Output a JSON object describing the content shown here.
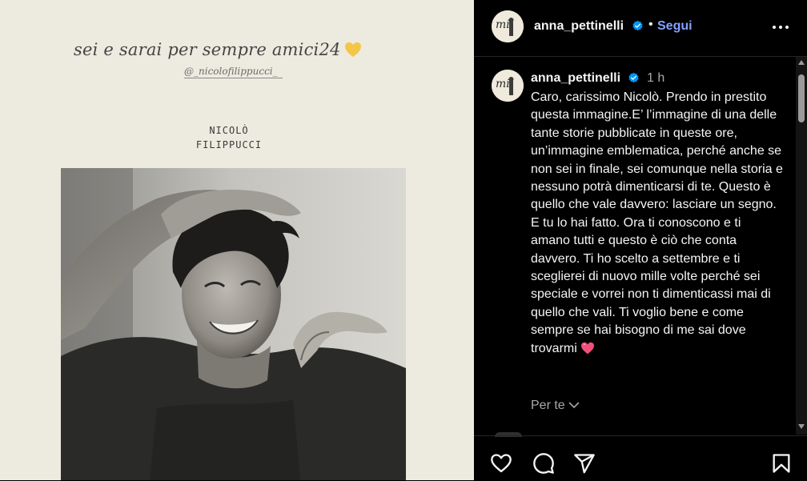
{
  "story": {
    "caption": "sei e sarai per sempre amici24",
    "mention": "@_nicolofilippucci_",
    "name_line1": "NICOLÒ",
    "name_line2": "FILIPPUCCI"
  },
  "header": {
    "username": "anna_pettinelli",
    "separator": "•",
    "follow_label": "Segui",
    "icons": [
      "verified-badge",
      "more-options-icon"
    ]
  },
  "comment": {
    "username": "anna_pettinelli",
    "time": "1 h",
    "text": "Caro, carissimo Nicolò. Prendo in prestito questa immagine.E’ l’immagine di una delle tante storie pubblicate in queste ore, un’immagine emblematica, perché anche se non sei in finale, sei comunque nella storia e nessuno potrà dimenticarsi di te. Questo è quello che vale davvero: lasciare un segno. E tu lo hai fatto. Ora ti conoscono e ti amano tutti e questo è ciò che conta davvero. Ti ho scelto a settembre e ti sceglierei di nuovo mille volte perché sei speciale e vorrei non ti dimenticassi mai di quello che vali. Ti voglio bene e come sempre se hai bisogno di me sai dove trovarmi",
    "translate_label": "Per te"
  },
  "actions": [
    "heart-icon",
    "comment-icon",
    "share-icon",
    "bookmark-icon"
  ],
  "colors": {
    "panel_bg": "#000000",
    "link_blue": "#85a1ff",
    "verified_blue": "#0095f6",
    "muted_text": "#a8a8a8",
    "story_bg": "#edeadf",
    "heart_pink": "#f0507a",
    "heart_yellow": "#f3c64a"
  }
}
